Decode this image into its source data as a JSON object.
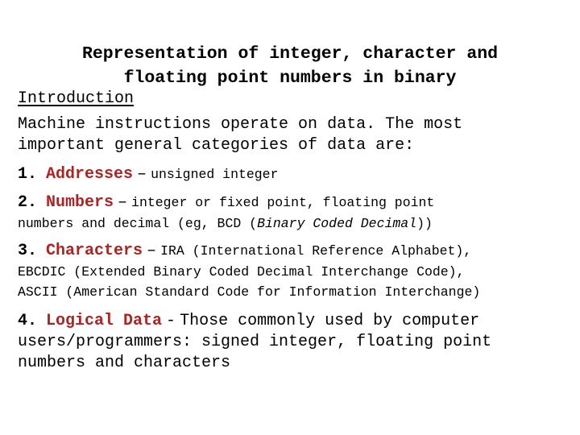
{
  "slide": {
    "title": "Representation of integer, character and\nfloating point numbers in binary",
    "accent_color": "#b22222",
    "text_color": "#000000",
    "background_color": "#ffffff",
    "section_heading": "Introduction",
    "intro_paragraph": "Machine instructions operate on data. The most\nimportant general categories of data are:",
    "items": [
      {
        "number": "1.",
        "keyword": "Addresses",
        "dash": "–",
        "description": "unsigned integer",
        "continuation": ""
      },
      {
        "number": "2.",
        "keyword": "Numbers",
        "dash": "–",
        "description": "integer or fixed point, floating point",
        "continuation_prefix": "numbers and decimal (eg, BCD (",
        "continuation_italic": "Binary Coded Decimal",
        "continuation_suffix": "))"
      },
      {
        "number": "3.",
        "keyword": "Characters",
        "dash": "–",
        "description": "IRA (International Reference Alphabet),",
        "continuation_line_1": "EBCDIC (Extended Binary Coded Decimal Interchange Code),",
        "continuation_line_2": "ASCII (American Standard Code for Information Interchange)"
      },
      {
        "number": "4.",
        "keyword": "Logical Data",
        "dash": "-",
        "description": "Those commonly used by computer",
        "continuation_line_1": "users/programmers: signed integer, floating point",
        "continuation_line_2": "numbers and characters"
      }
    ]
  }
}
